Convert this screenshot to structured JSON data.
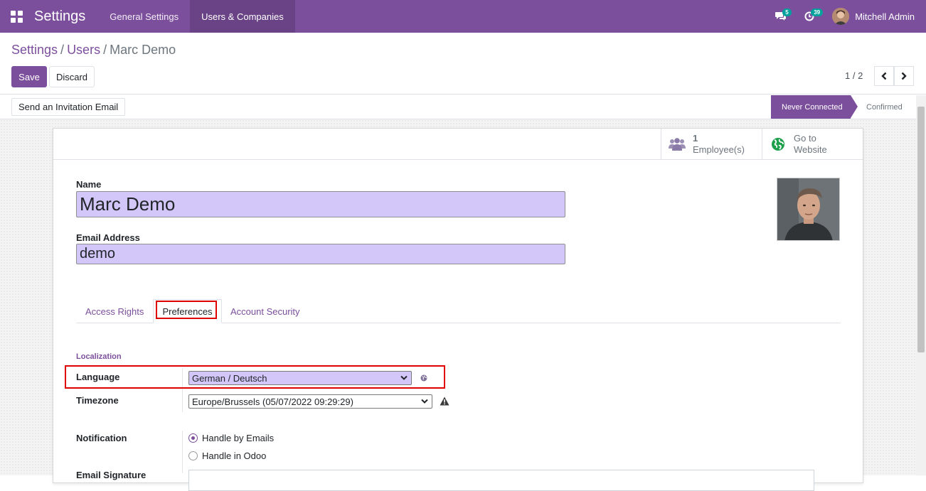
{
  "navbar": {
    "app_title": "Settings",
    "menu": [
      {
        "label": "General Settings",
        "active": false
      },
      {
        "label": "Users & Companies",
        "active": true
      }
    ],
    "messages_count": "5",
    "activities_count": "39",
    "user_name": "Mitchell Admin",
    "icons": [
      "apps-grid-icon",
      "chat-bubbles-icon",
      "clock-icon"
    ]
  },
  "breadcrumb": {
    "root": "Settings",
    "parent": "Users",
    "current": "Marc Demo",
    "separator": "/"
  },
  "actions": {
    "save_label": "Save",
    "discard_label": "Discard"
  },
  "pager": {
    "value": "1 / 2"
  },
  "statusbar": {
    "invite_label": "Send an Invitation Email",
    "stages": [
      {
        "label": "Never Connected",
        "active": true
      },
      {
        "label": "Confirmed",
        "active": false
      }
    ]
  },
  "smart_buttons": {
    "employees_count": "1",
    "employees_label": "Employee(s)",
    "website_line1": "Go to",
    "website_line2": "Website"
  },
  "form": {
    "name_label": "Name",
    "name_value": "Marc Demo",
    "email_label": "Email Address",
    "email_value": "demo"
  },
  "tabs": [
    {
      "label": "Access Rights",
      "active": false
    },
    {
      "label": "Preferences",
      "active": true
    },
    {
      "label": "Account Security",
      "active": false
    }
  ],
  "preferences": {
    "group_title": "Localization",
    "language_label": "Language",
    "language_value": "German / Deutsch",
    "timezone_label": "Timezone",
    "timezone_value": "Europe/Brussels (05/07/2022 09:29:29)",
    "notification_label": "Notification",
    "notification_options": [
      {
        "label": "Handle by Emails",
        "checked": true
      },
      {
        "label": "Handle in Odoo",
        "checked": false
      }
    ],
    "signature_label": "Email Signature"
  },
  "colors": {
    "brand": "#7c4f9d",
    "field_highlight": "#d2c7f8",
    "annotation_red": "#e00000",
    "badge": "#00a09d"
  }
}
